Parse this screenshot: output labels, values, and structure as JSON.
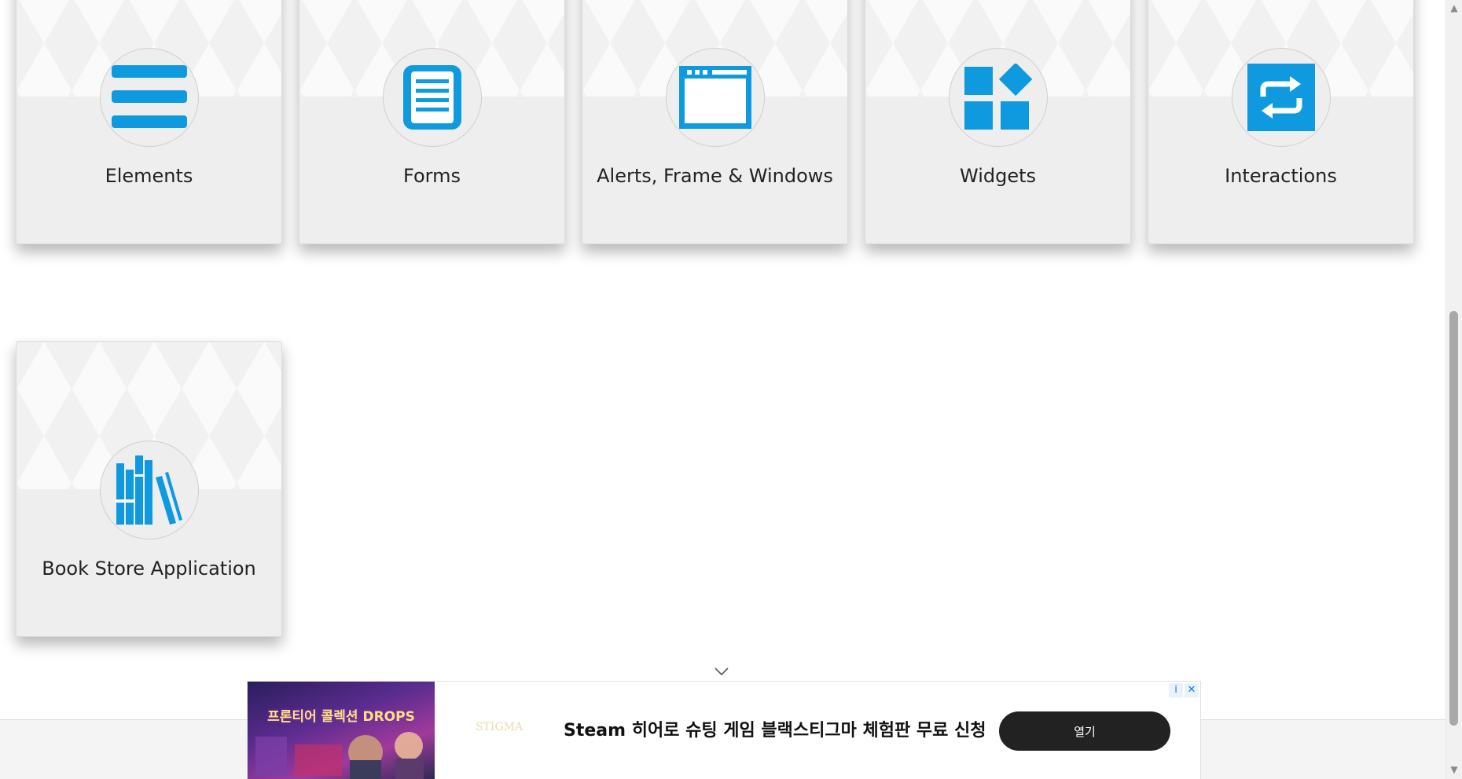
{
  "cards": [
    {
      "title": "Elements",
      "icon": "menu-lines-icon"
    },
    {
      "title": "Forms",
      "icon": "document-form-icon"
    },
    {
      "title": "Alerts, Frame & Windows",
      "icon": "browser-window-icon"
    },
    {
      "title": "Widgets",
      "icon": "widgets-icon"
    },
    {
      "title": "Interactions",
      "icon": "repeat-arrows-icon"
    },
    {
      "title": "Book Store Application",
      "icon": "books-icon"
    }
  ],
  "ad": {
    "headline": "Steam 히어로 슈팅 게임 블랙스티그마 체험판 무료 신청",
    "button_label": "열기",
    "image_title": "프론티어 콜렉션 DROPS",
    "brand_text": "STIGMA",
    "info_glyph": "i",
    "close_glyph": "✕"
  },
  "colors": {
    "accent": "#0f9ae0",
    "card_bg": "#eeeeee"
  }
}
